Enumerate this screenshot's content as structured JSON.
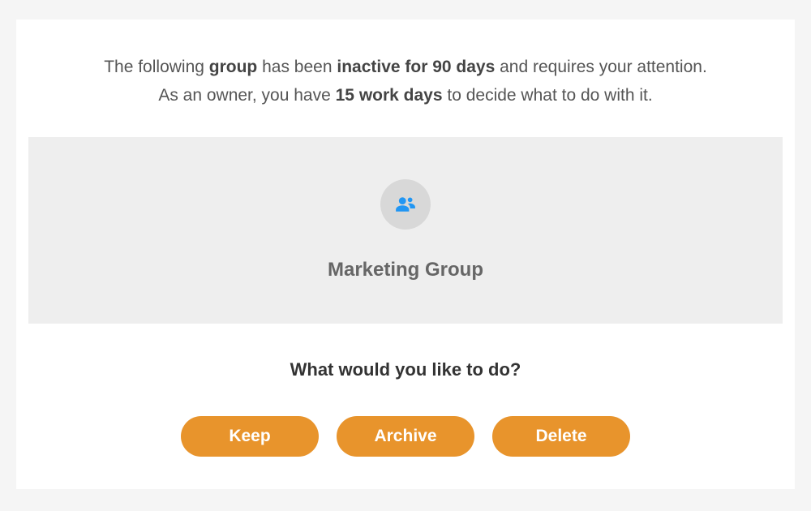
{
  "message": {
    "part1": "The following ",
    "bold1": "group",
    "part2": " has been ",
    "bold2": "inactive for 90 days",
    "part3": " and requires your attention.",
    "part4": "As an owner, you have ",
    "bold3": "15 work days",
    "part5": " to decide what to do with it."
  },
  "group": {
    "name": "Marketing Group",
    "icon": "group-people-icon"
  },
  "prompt": "What would you like to do?",
  "actions": {
    "keep": "Keep",
    "archive": "Archive",
    "delete": "Delete"
  },
  "colors": {
    "accent": "#e8942c",
    "icon": "#2196f3",
    "panelBg": "#eeeeee",
    "cardBg": "#ffffff",
    "pageBg": "#f5f5f5"
  }
}
